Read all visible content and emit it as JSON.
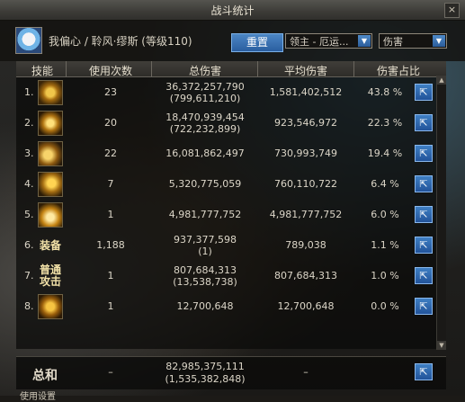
{
  "window": {
    "title": "战斗统计",
    "close": "×"
  },
  "header": {
    "player_name": "我偏心 / 聆风·缪斯 (等级110)",
    "reset_label": "重置",
    "boss_select": "领主 - 厄运...",
    "type_select": "伤害"
  },
  "columns": [
    "技能",
    "使用次数",
    "总伤害",
    "平均伤害",
    "伤害占比"
  ],
  "rows": [
    {
      "index": "1.",
      "icon": "skill-icon-1",
      "icon_text": "",
      "uses": "23",
      "total": "36,372,257,790",
      "total_sub": "(799,611,210)",
      "avg": "1,581,402,512",
      "pct": "43.8 %"
    },
    {
      "index": "2.",
      "icon": "skill-icon-2",
      "icon_text": "",
      "uses": "20",
      "total": "18,470,939,454",
      "total_sub": "(722,232,899)",
      "avg": "923,546,972",
      "pct": "22.3 %"
    },
    {
      "index": "3.",
      "icon": "skill-icon-3",
      "icon_text": "",
      "uses": "22",
      "total": "16,081,862,497",
      "total_sub": "",
      "avg": "730,993,749",
      "pct": "19.4 %"
    },
    {
      "index": "4.",
      "icon": "skill-icon-4",
      "icon_text": "",
      "uses": "7",
      "total": "5,320,775,059",
      "total_sub": "",
      "avg": "760,110,722",
      "pct": "6.4 %"
    },
    {
      "index": "5.",
      "icon": "skill-icon-5",
      "icon_text": "",
      "uses": "1",
      "total": "4,981,777,752",
      "total_sub": "",
      "avg": "4,981,777,752",
      "pct": "6.0 %"
    },
    {
      "index": "6.",
      "icon": "equipment-text-icon",
      "icon_text": "装备",
      "uses": "1,188",
      "total": "937,377,598",
      "total_sub": "(1)",
      "avg": "789,038",
      "pct": "1.1 %"
    },
    {
      "index": "7.",
      "icon": "normal-attack-text-icon",
      "icon_text": "普通\n攻击",
      "uses": "1",
      "total": "807,684,313",
      "total_sub": "(13,538,738)",
      "avg": "807,684,313",
      "pct": "1.0 %"
    },
    {
      "index": "8.",
      "icon": "skill-icon-8",
      "icon_text": "",
      "uses": "1",
      "total": "12,700,648",
      "total_sub": "",
      "avg": "12,700,648",
      "pct": "0.0 %"
    }
  ],
  "total_row": {
    "label": "总和",
    "uses": "–",
    "total": "82,985,375,111",
    "total_sub": "(1,535,382,848)",
    "avg": "–"
  },
  "footer": {
    "text": "使用设置"
  },
  "colors": {
    "accent_blue": "#2f6db3",
    "gold": "#d9a62b"
  }
}
